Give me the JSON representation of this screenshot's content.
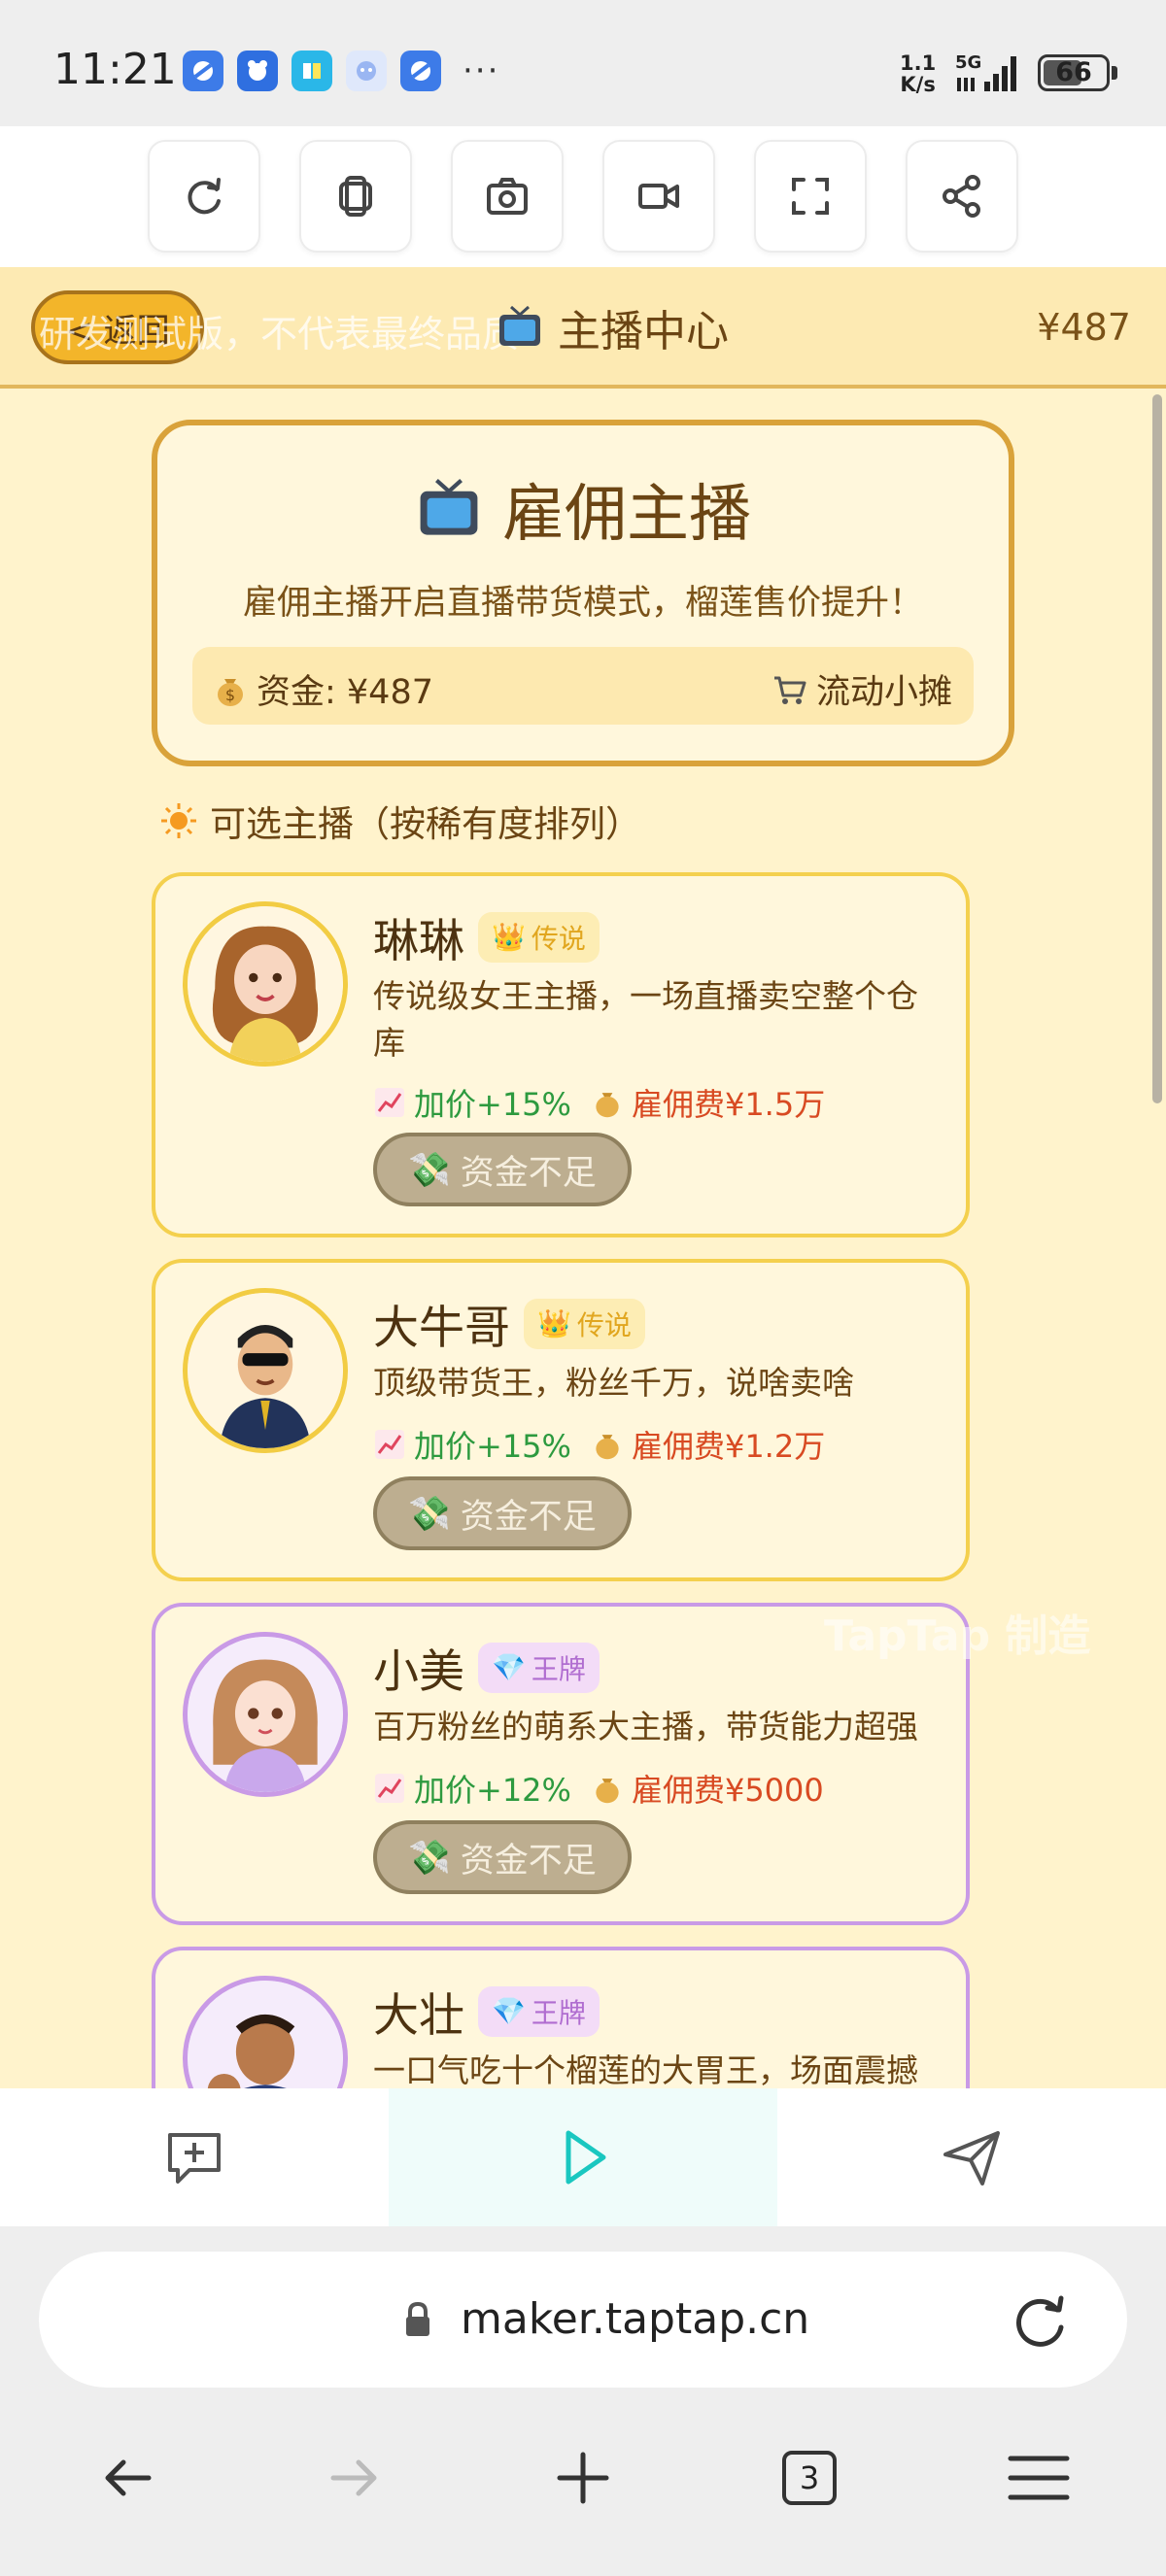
{
  "status": {
    "time": "11:21",
    "net_speed_top": "1.1",
    "net_speed_bottom": "K/s",
    "network": "5G",
    "battery": "66"
  },
  "toolbar": {
    "buttons": [
      "refresh-icon",
      "copy-icon",
      "screenshot-icon",
      "record-video-icon",
      "fullscreen-icon",
      "share-icon"
    ]
  },
  "header": {
    "back_label": "< 返回",
    "dev_watermark": "研发测试版，不代表最终品质",
    "title": "主播中心",
    "money": "¥487"
  },
  "hire": {
    "title": "雇佣主播",
    "desc": "雇佣主播开启直播带货模式，榴莲售价提升！",
    "fund": "资金: ¥487",
    "stall": "流动小摊"
  },
  "section_title": "可选主播（按稀有度排列）",
  "anchors": [
    {
      "name": "琳琳",
      "rarity": "传说",
      "desc": "传说级女王主播，一场直播卖空整个仓库",
      "boost": "加价+15%",
      "fee": "雇佣费¥1.5万",
      "button": "资金不足"
    },
    {
      "name": "大牛哥",
      "rarity": "传说",
      "desc": "顶级带货王，粉丝千万，说啥卖啥",
      "boost": "加价+15%",
      "fee": "雇佣费¥1.2万",
      "button": "资金不足"
    },
    {
      "name": "小美",
      "rarity": "王牌",
      "desc": "百万粉丝的萌系大主播，带货能力超强",
      "boost": "加价+12%",
      "fee": "雇佣费¥5000",
      "button": "资金不足"
    },
    {
      "name": "大壮",
      "rarity": "王牌",
      "desc": "一口气吃十个榴莲的大胃王，场面震撼",
      "boost": "",
      "fee": "",
      "button": ""
    }
  ],
  "watermark": "TapTap 制造",
  "browser": {
    "url": "maker.taptap.cn",
    "tab_count": "3"
  },
  "colors": {
    "header_bg": "#fdeab3",
    "main_bg": "#fff3cc",
    "legend_border": "#f4d04e",
    "ace_border": "#c99ae6",
    "boost_green": "#2d9a3f",
    "fee_red": "#d84a22",
    "disabled_btn": "#bdae90"
  }
}
